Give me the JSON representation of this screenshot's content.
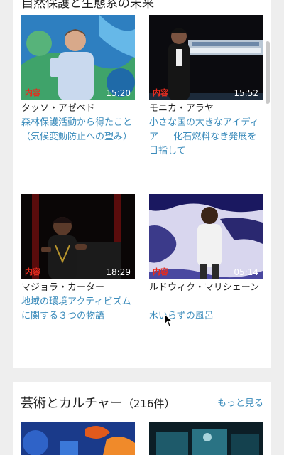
{
  "section": {
    "title_partial": "自然保護と生態系の未来"
  },
  "talks": [
    {
      "speaker": "タッソ・アゼベド",
      "title": "森林保護活動から得たこと（気候変動防止への望み）",
      "badge": "内容",
      "duration": "15:20"
    },
    {
      "speaker": "モニカ・アラヤ",
      "title": "小さな国の大きなアイディア — 化石燃料なき発展を目指して",
      "badge": "内容",
      "duration": "15:52"
    },
    {
      "speaker": "マジョラ・カーター",
      "title": "地域の環境アクティビズムに関する３つの物語",
      "badge": "内容",
      "duration": "18:29"
    },
    {
      "speaker": "ルドウィク・マリシェーン",
      "title": "水いらずの風呂",
      "badge": "内容",
      "duration": "05:14"
    }
  ],
  "category": {
    "title": "芸術とカルチャー",
    "count": "（216件）",
    "more": "もっと見る"
  },
  "colors": {
    "badge": "#e62b1e",
    "link": "#3a8bbb",
    "background": "#eeeeee"
  }
}
